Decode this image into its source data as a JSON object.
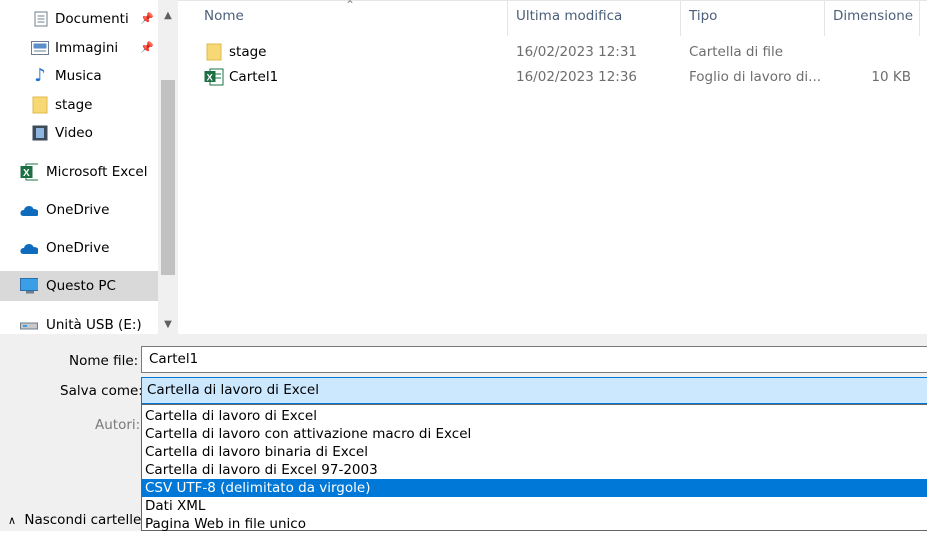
{
  "sidebar": {
    "items": [
      {
        "label": "Documenti",
        "icon": "document-icon"
      },
      {
        "label": "Immagini",
        "icon": "pictures-icon"
      },
      {
        "label": "Musica",
        "icon": "music-icon"
      },
      {
        "label": "stage",
        "icon": "folder-icon"
      },
      {
        "label": "Video",
        "icon": "video-icon"
      },
      {
        "label": "Microsoft Excel",
        "icon": "excel-icon"
      },
      {
        "label": "OneDrive",
        "icon": "onedrive-icon"
      },
      {
        "label": "OneDrive",
        "icon": "onedrive-icon"
      },
      {
        "label": "Questo PC",
        "icon": "computer-icon"
      },
      {
        "label": "Unità USB (E:)",
        "icon": "usb-drive-icon"
      }
    ]
  },
  "columns": {
    "name": "Nome",
    "modified": "Ultima modifica",
    "type": "Tipo",
    "size": "Dimensione"
  },
  "files": [
    {
      "name": "stage",
      "modified": "16/02/2023 12:31",
      "type": "Cartella di file",
      "size": ""
    },
    {
      "name": "Cartel1",
      "modified": "16/02/2023 12:36",
      "type": "Foglio di lavoro di...",
      "size": "10 KB"
    }
  ],
  "form": {
    "filename_label": "Nome file:",
    "filename_value": "Cartel1",
    "saveas_label": "Salva come:",
    "saveas_value": "Cartella di lavoro di Excel",
    "authors_label": "Autori:"
  },
  "saveas_options": [
    "Cartella di lavoro di Excel",
    "Cartella di lavoro con attivazione macro di Excel",
    "Cartella di lavoro binaria di Excel",
    "Cartella di lavoro di Excel 97-2003",
    "CSV UTF-8 (delimitato da virgole)",
    "Dati XML",
    "Pagina Web in file unico"
  ],
  "selected_option": "CSV UTF-8 (delimitato da virgole)",
  "hide_folders_label": "Nascondi cartelle",
  "colors": {
    "accent": "#0078d7",
    "selection_bg": "#cce8ff",
    "header_text": "#4c607a"
  }
}
